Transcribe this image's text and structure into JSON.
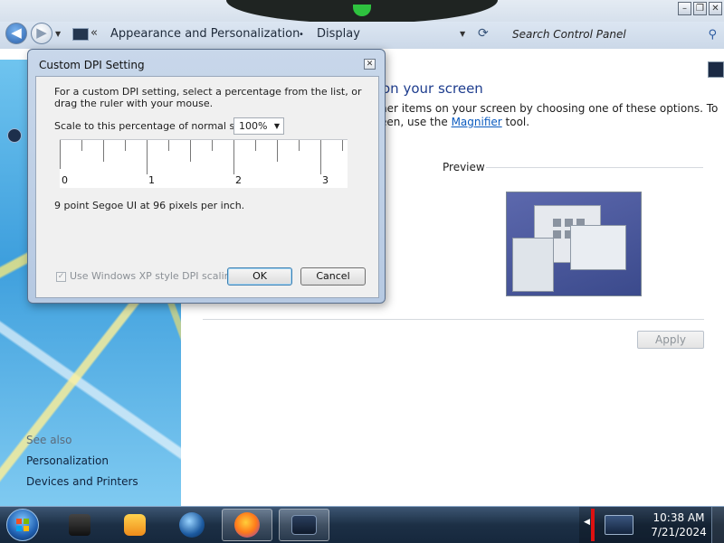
{
  "window": {
    "controls": {
      "minimize": "–",
      "restore": "❐",
      "close": "✕"
    }
  },
  "nav": {
    "back_icon": "◀",
    "forward_icon": "▶",
    "dropdown_icon": "▼",
    "overflow": "«",
    "breadcrumb": [
      "Appearance and Personalization",
      "Display"
    ],
    "breadcrumb_sep": "•",
    "refresh_icon": "⟳",
    "search_placeholder": "Search Control Panel",
    "search_icon": "⚲"
  },
  "main": {
    "heading_partial": "on your screen",
    "desc_line1": "her items on your screen by choosing one of these options. To",
    "desc_line2_prefix": "een, use the ",
    "desc_link": "Magnifier",
    "desc_line2_suffix": " tool.",
    "preview_label": "Preview",
    "apply_label": "Apply"
  },
  "sidebar": {
    "see_also": "See also",
    "links": [
      "Personalization",
      "Devices and Printers"
    ]
  },
  "dialog": {
    "title": "Custom DPI Setting",
    "close_icon": "✕",
    "intro_line1": "For a custom DPI setting, select a percentage from the list, or",
    "intro_line2": "drag the ruler with your mouse.",
    "scale_label": "Scale to this percentage of normal size:",
    "scale_value": "100%",
    "ruler_labels": [
      "0",
      "1",
      "2",
      "3"
    ],
    "font_info": "9 point Segoe UI at 96 pixels per inch.",
    "xp_checkbox_label": "Use Windows XP style DPI scaling",
    "xp_checkbox_checked": true,
    "ok_label": "OK",
    "cancel_label": "Cancel"
  },
  "taskbar": {
    "items": [
      "start-orb",
      "dark-app",
      "media-player",
      "globe",
      "firefox",
      "display-settings"
    ],
    "time": "10:38 AM",
    "date": "7/21/2024"
  },
  "colors": {
    "accent": "#1e3d8e",
    "link": "#0b5bbf",
    "taskbar": "#1c2f45"
  }
}
